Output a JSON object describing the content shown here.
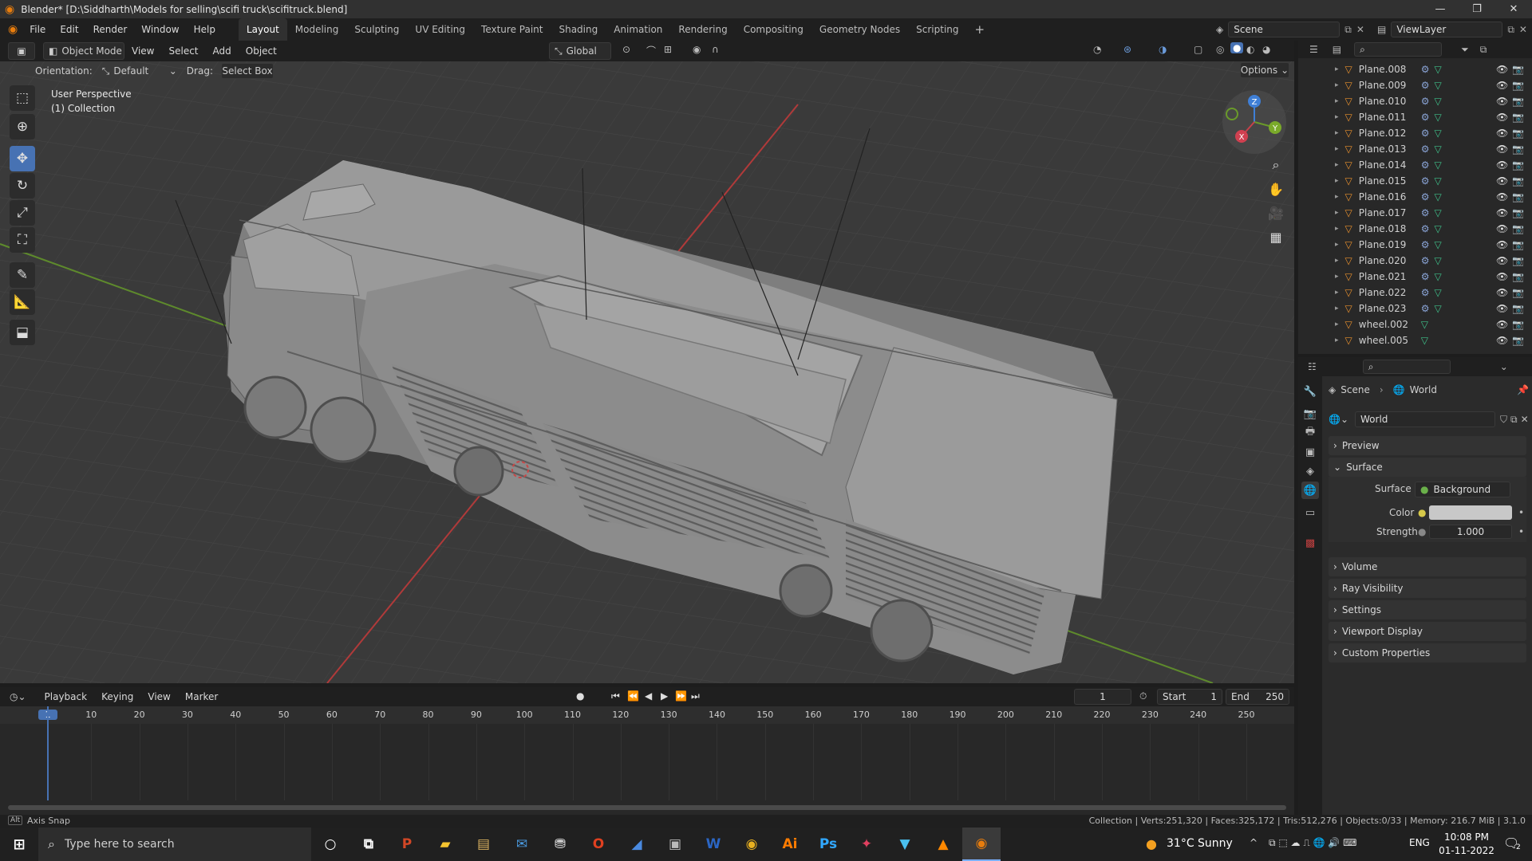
{
  "window": {
    "title": "Blender* [D:\\Siddharth\\Models for selling\\scifi truck\\scifitruck.blend]",
    "minimize": "—",
    "maximize": "❐",
    "close": "✕"
  },
  "menus": [
    "File",
    "Edit",
    "Render",
    "Window",
    "Help"
  ],
  "workspaces": [
    "Layout",
    "Modeling",
    "Sculpting",
    "UV Editing",
    "Texture Paint",
    "Shading",
    "Animation",
    "Rendering",
    "Compositing",
    "Geometry Nodes",
    "Scripting"
  ],
  "workspace_add": "+",
  "scene": {
    "name": "Scene",
    "view_layer": "ViewLayer"
  },
  "viewport": {
    "mode": "Object Mode",
    "menus": [
      "View",
      "Select",
      "Add",
      "Object"
    ],
    "transform_orientation": "Global",
    "orientation_label": "Orientation:",
    "orientation_value": "Default",
    "drag_label": "Drag:",
    "drag_value": "Select Box",
    "options_label": "Options",
    "overlay_line1": "User Perspective",
    "overlay_line2": "(1) Collection",
    "gizmo": {
      "z": "Z",
      "y": "Y",
      "x": "X"
    }
  },
  "outliner": {
    "items": [
      "Plane.008",
      "Plane.009",
      "Plane.010",
      "Plane.011",
      "Plane.012",
      "Plane.013",
      "Plane.014",
      "Plane.015",
      "Plane.016",
      "Plane.017",
      "Plane.018",
      "Plane.019",
      "Plane.020",
      "Plane.021",
      "Plane.022",
      "Plane.023",
      "wheel.002",
      "wheel.005"
    ]
  },
  "properties": {
    "breadcrumb_scene": "Scene",
    "breadcrumb_world": "World",
    "world_name": "World",
    "panels": {
      "preview": "Preview",
      "surface": "Surface",
      "volume": "Volume",
      "ray_visibility": "Ray Visibility",
      "settings": "Settings",
      "viewport_display": "Viewport Display",
      "custom_properties": "Custom Properties"
    },
    "surface_label": "Surface",
    "surface_value": "Background",
    "color_label": "Color",
    "strength_label": "Strength",
    "strength_value": "1.000",
    "color_value": "#c8c8c8"
  },
  "timeline": {
    "menus": [
      "Playback",
      "Keying",
      "View",
      "Marker"
    ],
    "current_frame": "1",
    "start_label": "Start",
    "start_value": "1",
    "end_label": "End",
    "end_value": "250",
    "ruler": [
      "1",
      "10",
      "20",
      "30",
      "40",
      "50",
      "60",
      "70",
      "80",
      "90",
      "100",
      "110",
      "120",
      "130",
      "140",
      "150",
      "160",
      "170",
      "180",
      "190",
      "200",
      "210",
      "220",
      "230",
      "240",
      "250"
    ]
  },
  "statusbar": {
    "left_key": "Alt",
    "left_text": "Axis Snap",
    "right_text": "Collection | Verts:251,320 | Faces:325,172 | Tris:512,276 | Objects:0/33 | Memory: 216.7 MiB | 3.1.0"
  },
  "taskbar": {
    "search_placeholder": "Type here to search",
    "weather": "31°C  Sunny",
    "lang": "ENG",
    "time": "10:08 PM",
    "date": "01-11-2022",
    "notif_count": "2"
  },
  "colors": {
    "accent": "#4772b3",
    "x_axis": "#c8404a",
    "y_axis": "#6a9a2a",
    "z_axis": "#3f7fd6",
    "mesh_icon": "#e8902e"
  }
}
